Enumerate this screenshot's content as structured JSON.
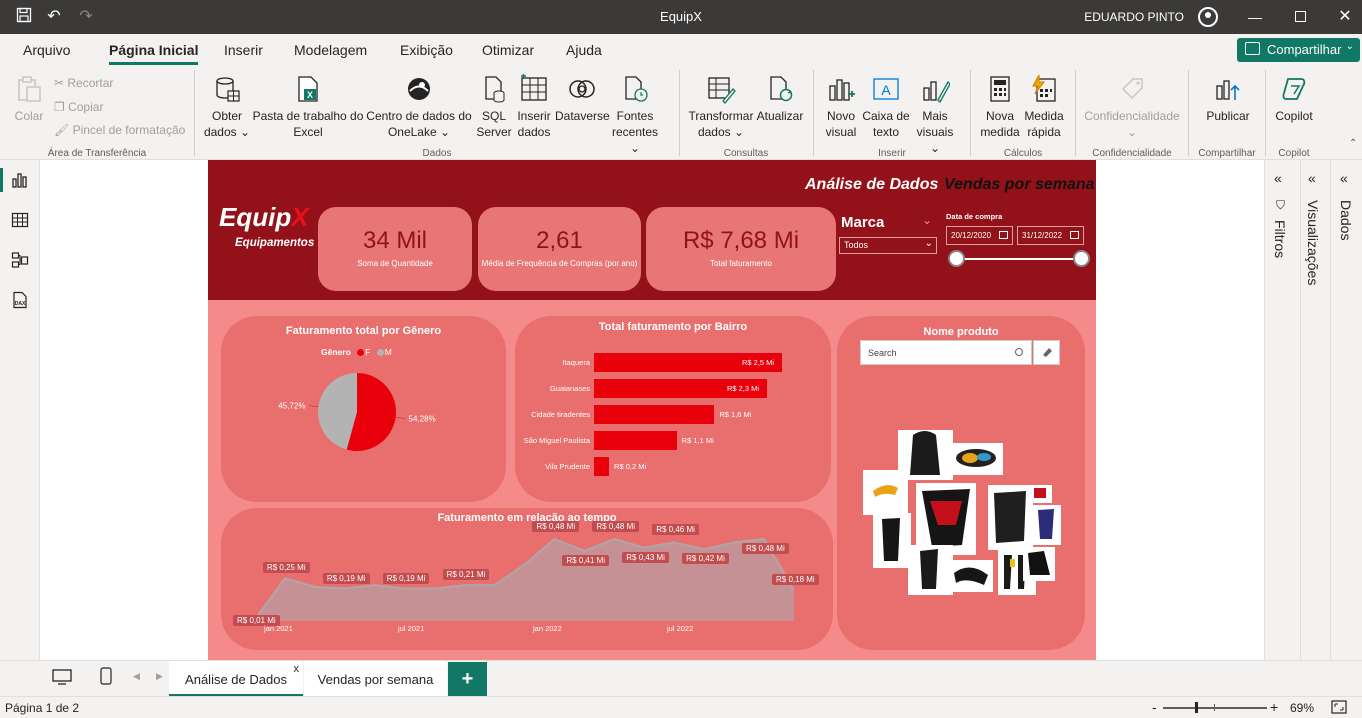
{
  "app": {
    "title": "EquipX",
    "user": "EDUARDO PINTO"
  },
  "menu": {
    "items": [
      "Arquivo",
      "Página Inicial",
      "Inserir",
      "Modelagem",
      "Exibição",
      "Otimizar",
      "Ajuda"
    ],
    "active": "Página Inicial",
    "share_label": "Compartilhar"
  },
  "ribbon": {
    "clipboard": {
      "paste": "Colar",
      "cut": "Recortar",
      "copy": "Copiar",
      "format_painter": "Pincel de formatação",
      "group": "Área de Transferência"
    },
    "data": {
      "get_data": [
        "Obter",
        "dados ⌄"
      ],
      "excel": [
        "Pasta de trabalho do",
        "Excel"
      ],
      "onelake": [
        "Centro de dados do",
        "OneLake ⌄"
      ],
      "sql": [
        "SQL",
        "Server"
      ],
      "enter_data": [
        "Inserir",
        "dados"
      ],
      "dataverse": [
        "Dataverse",
        ""
      ],
      "recent": [
        "Fontes",
        "recentes ⌄"
      ],
      "group": "Dados"
    },
    "queries": {
      "transform": [
        "Transformar",
        "dados ⌄"
      ],
      "refresh": [
        "Atualizar",
        ""
      ],
      "group": "Consultas"
    },
    "insert": {
      "new_visual": [
        "Novo",
        "visual"
      ],
      "text_box": [
        "Caixa de",
        "texto"
      ],
      "more_visuals": [
        "Mais",
        "visuais ⌄"
      ],
      "group": "Inserir"
    },
    "calculations": {
      "new_measure": [
        "Nova",
        "medida"
      ],
      "quick_measure": [
        "Medida",
        "rápida"
      ],
      "group": "Cálculos"
    },
    "sensitivity": {
      "label": "Confidencialidade",
      "group": "Confidencialidade"
    },
    "share": {
      "publish": "Publicar",
      "group": "Compartilhar"
    },
    "copilot": {
      "label": "Copilot",
      "group": "Copilot"
    }
  },
  "report": {
    "logo": {
      "main": "Equip",
      "x": "X",
      "sub": "Equipamentos"
    },
    "tabs_header": {
      "tab1": "Análise de Dados",
      "tab2": "Vendas por semana"
    },
    "kpis": [
      {
        "value": "34 Mil",
        "label": "Soma de Quantidade"
      },
      {
        "value": "2,61",
        "label": "Média de Frequência de Compras (por ano)"
      },
      {
        "value": "R$ 7,68 Mi",
        "label": "Total faturamento"
      }
    ],
    "brand_slicer": {
      "title": "Marca",
      "value": "Todos"
    },
    "date_slicer": {
      "title": "Data de compra",
      "start": "20/12/2020",
      "end": "31/12/2022"
    },
    "pie": {
      "title": "Faturamento total por Gênero",
      "legend_title": "Gênero",
      "labels": [
        "F",
        "M"
      ],
      "values": [
        54.28,
        45.72
      ],
      "value_labels": [
        "54,28%",
        "45,72%"
      ],
      "colors": [
        "#e8000b",
        "#b3b3b3"
      ]
    },
    "bar": {
      "title": "Total faturamento por Bairro",
      "categories": [
        "Itaquera",
        "Guaianases",
        "Cidade tiradentes",
        "São Miguel Paulista",
        "Vila Prudente"
      ],
      "values": [
        2.5,
        2.3,
        1.6,
        1.1,
        0.2
      ],
      "value_labels": [
        "R$ 2,5 Mi",
        "R$ 2,3 Mi",
        "R$ 1,6 Mi",
        "R$ 1,1 Mi",
        "R$ 0,2 Mi"
      ]
    },
    "products": {
      "title": "Nome produto",
      "search_placeholder": "Search"
    },
    "area": {
      "title": "Faturamento em relação ao tempo",
      "x_labels": [
        "jan 2021",
        "jul 2021",
        "jan 2022",
        "jul 2022"
      ]
    }
  },
  "chart_data": [
    {
      "type": "pie",
      "title": "Faturamento total por Gênero",
      "categories": [
        "F",
        "M"
      ],
      "values": [
        54.28,
        45.72
      ]
    },
    {
      "type": "bar",
      "title": "Total faturamento por Bairro",
      "categories": [
        "Itaquera",
        "Guaianases",
        "Cidade tiradentes",
        "São Miguel Paulista",
        "Vila Prudente"
      ],
      "values": [
        2.5,
        2.3,
        1.6,
        1.1,
        0.2
      ]
    },
    {
      "type": "area",
      "title": "Faturamento em relação ao tempo",
      "x": [
        "dez 2020",
        "fev 2021",
        "abr 2021",
        "mai 2021",
        "jun 2021",
        "jul 2021",
        "ago 2021",
        "out 2021",
        "nov 2021",
        "jan 2022",
        "fev 2022",
        "abr 2022",
        "mai 2022",
        "jun 2022",
        "ago 2022",
        "set 2022",
        "out 2022",
        "nov 2022",
        "dez 2022"
      ],
      "values": [
        0.01,
        0.25,
        0.2,
        0.19,
        0.21,
        0.19,
        0.19,
        0.21,
        0.21,
        0.33,
        0.48,
        0.41,
        0.48,
        0.43,
        0.46,
        0.42,
        0.46,
        0.48,
        0.18
      ],
      "point_labels": [
        "R$ 0,01 Mi",
        "R$ 0,25 Mi",
        "",
        "R$ 0,19 Mi",
        "",
        "R$ 0,19 Mi",
        "",
        "R$ 0,21 Mi",
        "",
        "",
        "R$ 0,48 Mi",
        "R$ 0,41 Mi",
        "R$ 0,48 Mi",
        "R$ 0,43 Mi",
        "R$ 0,46 Mi",
        "R$ 0,42 Mi",
        "",
        "R$ 0,48 Mi",
        "R$ 0,18 Mi"
      ],
      "x_tick_labels": [
        "jan 2021",
        "jul 2021",
        "jan 2022",
        "jul 2022"
      ]
    }
  ],
  "right_panes": {
    "filters": "Filtros",
    "visualizations": "Visualizações",
    "data": "Dados"
  },
  "page_tabs": {
    "tab1": "Análise de Dados",
    "tab2": "Vendas por semana",
    "close": "x",
    "add": "+"
  },
  "status": {
    "page": "Página 1 de 2",
    "zoom": "69%"
  }
}
